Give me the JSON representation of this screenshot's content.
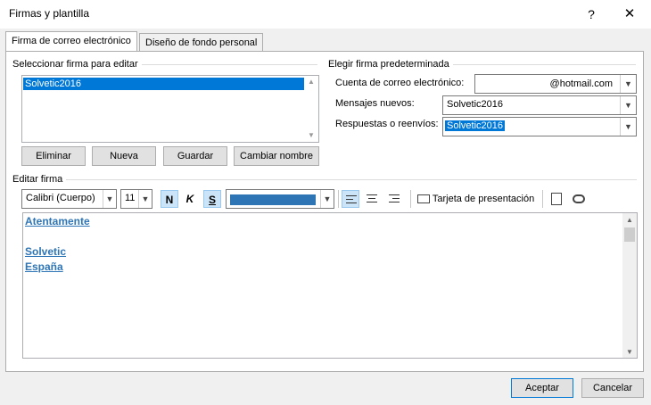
{
  "window": {
    "title": "Firmas y plantilla",
    "help": "?",
    "close": "✕"
  },
  "tabs": [
    {
      "label": "Firma de correo electrónico"
    },
    {
      "label": "Diseño de fondo personal"
    }
  ],
  "select_signature": {
    "label": "Seleccionar firma para editar",
    "items": [
      "Solvetic2016"
    ],
    "buttons": {
      "delete": "Eliminar",
      "new": "Nueva",
      "save": "Guardar",
      "rename": "Cambiar nombre"
    }
  },
  "default_signature": {
    "label": "Elegir firma predeterminada",
    "account_label": "Cuenta de correo electrónico:",
    "account_value": "@hotmail.com",
    "new_messages_label": "Mensajes nuevos:",
    "new_messages_value": "Solvetic2016",
    "replies_label": "Respuestas o reenvíos:",
    "replies_value": "Solvetic2016"
  },
  "edit_signature": {
    "label": "Editar firma",
    "font": "Calibri (Cuerpo)",
    "size": "11",
    "bold": "N",
    "italic": "K",
    "underline": "S",
    "business_card": "Tarjeta de presentación",
    "font_color": "#2e75b6",
    "lines": [
      "Atentamente",
      "",
      "Solvetic",
      "España"
    ]
  },
  "footer": {
    "ok": "Aceptar",
    "cancel": "Cancelar"
  }
}
